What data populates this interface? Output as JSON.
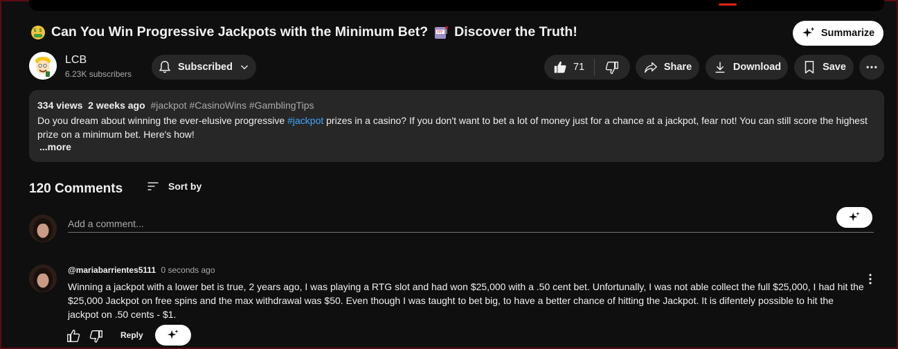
{
  "video": {
    "title": "Can You Win Progressive Jackpots with the Minimum Bet?",
    "title_suffix": "Discover the Truth!"
  },
  "summarize_label": "Summarize",
  "channel": {
    "name": "LCB",
    "subscribers": "6.23K subscribers"
  },
  "subscribe": {
    "label": "Subscribed"
  },
  "actions": {
    "like_count": "71",
    "share_label": "Share",
    "download_label": "Download",
    "save_label": "Save"
  },
  "description": {
    "views": "334 views",
    "age": "2 weeks ago",
    "tags": "#jackpot #CasinoWins #GamblingTips",
    "text_before": "Do you dream about winning the ever-elusive progressive",
    "link": "#jackpot",
    "text_after": "prizes in a casino? If you don't want to bet a lot of money just for a chance at a jackpot, fear not! You can still score the highest prize on a minimum bet. Here's how!",
    "more_label": "...more"
  },
  "comments": {
    "count_label": "120 Comments",
    "sort_label": "Sort by",
    "add_placeholder": "Add a comment...",
    "items": [
      {
        "handle": "@mariabarrientes5111",
        "time": "0 seconds ago",
        "text": "Winning a jackpot with a lower bet is true, 2 years ago, I was playing a RTG slot and had won $25,000 with a .50 cent bet. Unfortunally, I was not able collect the full $25,000, I  had hit the $25,000 Jackpot on free spins and the max withdrawal was $50. Even though I was taught to bet big, to have a better chance of hitting the Jackpot. It is difentely possible to hit the jackpot on .50 cents - $1.",
        "reply_label": "Reply"
      }
    ]
  },
  "colors": {
    "accent_red": "#e62117",
    "link_blue": "#3ea6ff",
    "pill_bg": "#272727",
    "bg": "#0f0f0f"
  }
}
